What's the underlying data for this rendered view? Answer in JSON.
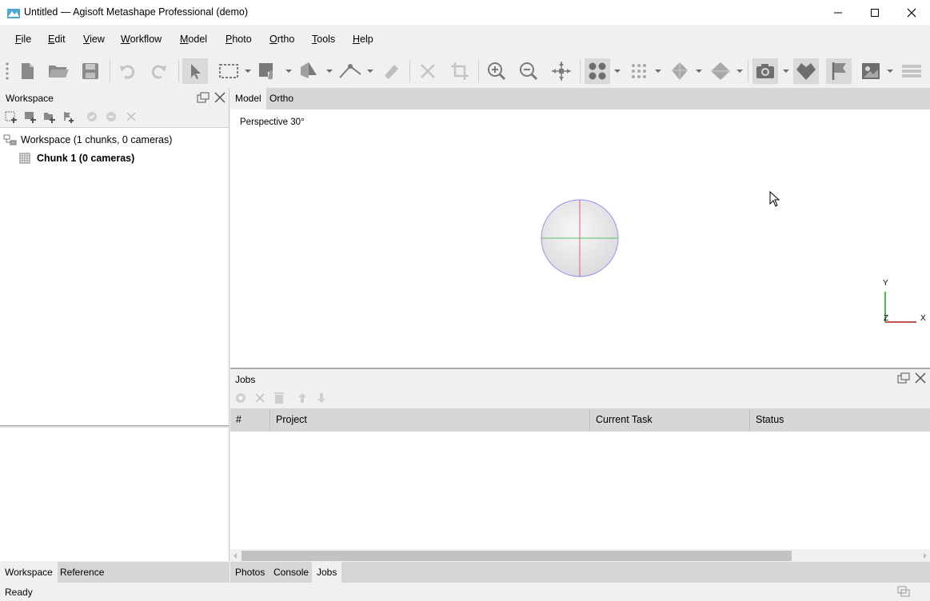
{
  "window": {
    "title": "Untitled — Agisoft Metashape Professional (demo)",
    "minimize_icon": "minimize-icon",
    "maximize_icon": "maximize-icon",
    "close_icon": "close-icon"
  },
  "menu": {
    "items": [
      {
        "label": "File",
        "underline": "F"
      },
      {
        "label": "Edit",
        "underline": "E"
      },
      {
        "label": "View",
        "underline": "V"
      },
      {
        "label": "Workflow",
        "underline": "W"
      },
      {
        "label": "Model",
        "underline": "M"
      },
      {
        "label": "Photo",
        "underline": "P"
      },
      {
        "label": "Ortho",
        "underline": "O"
      },
      {
        "label": "Tools",
        "underline": "T"
      },
      {
        "label": "Help",
        "underline": "H"
      }
    ]
  },
  "toolbar": {
    "icons": [
      "new-file-icon",
      "open-folder-icon",
      "save-icon",
      "undo-icon",
      "redo-icon",
      "select-arrow-icon",
      "rectangle-select-icon",
      "shape-select-icon",
      "paint-select-icon",
      "draw-polyline-icon",
      "ruler-icon",
      "delete-icon",
      "crop-icon",
      "zoom-in-icon",
      "zoom-out-icon",
      "reset-view-icon",
      "show-points-icon",
      "show-dense-cloud-icon",
      "show-mesh-icon",
      "show-tiled-model-icon",
      "show-cameras-icon",
      "show-shapes-icon",
      "show-markers-icon",
      "show-images-icon",
      "show-layers-icon"
    ]
  },
  "workspace": {
    "title": "Workspace",
    "tree": [
      {
        "label": "Workspace (1 chunks, 0 cameras)",
        "bold": false
      },
      {
        "label": "Chunk 1 (0 cameras)",
        "bold": true
      }
    ]
  },
  "viewport": {
    "tabs": [
      "Model",
      "Ortho"
    ],
    "active_tab": "Model",
    "projection_label": "Perspective 30°",
    "axis": {
      "y": "Y",
      "z": "Z",
      "x": "X"
    }
  },
  "jobs": {
    "title": "Jobs",
    "columns": [
      "#",
      "Project",
      "Current Task",
      "Status"
    ],
    "rows": []
  },
  "bottom_tabs_left": [
    "Workspace",
    "Reference"
  ],
  "bottom_tabs_right": [
    "Photos",
    "Console",
    "Jobs"
  ],
  "status": {
    "text": "Ready"
  }
}
